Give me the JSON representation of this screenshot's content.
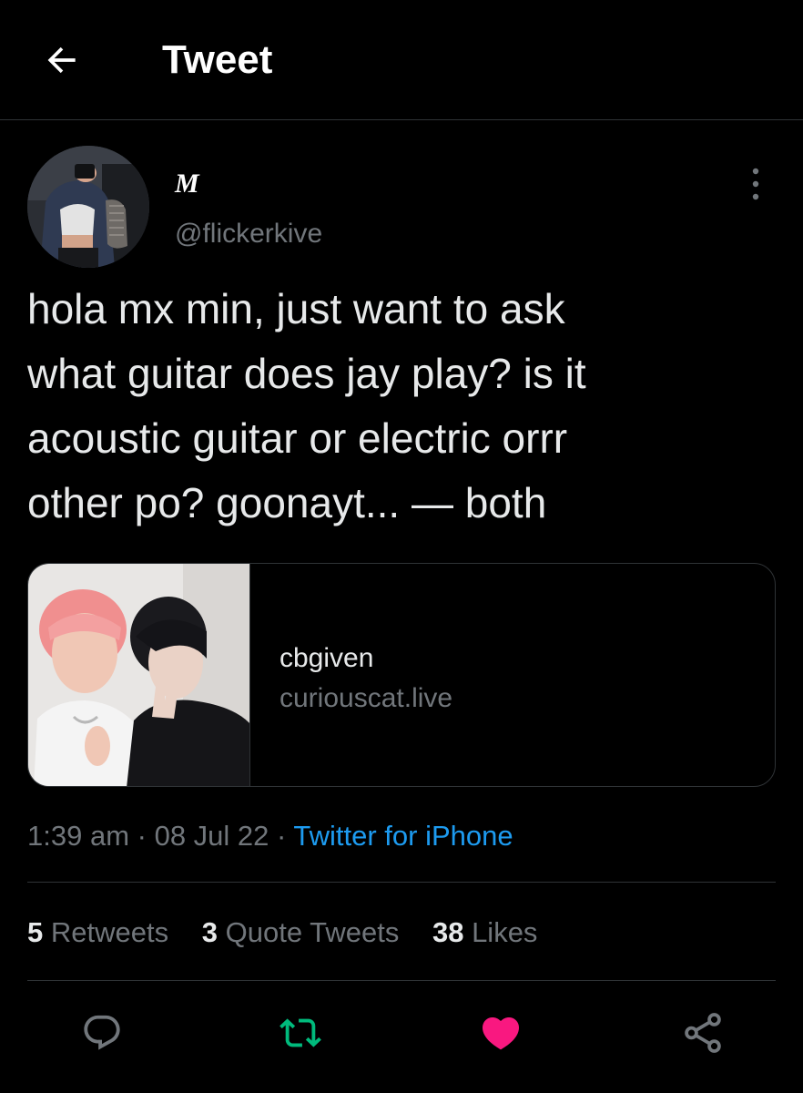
{
  "header": {
    "title": "Tweet",
    "back_icon": "arrow-left-icon"
  },
  "author": {
    "display_name": "M",
    "handle": "@flickerkive"
  },
  "tweet": {
    "text": "hola mx min, just want to ask\nwhat guitar does jay play? is it\nacoustic guitar or electric orrr\nother po? goonayt... — both"
  },
  "card": {
    "title": "cbgiven",
    "domain": "curiouscat.live"
  },
  "meta": {
    "time": "1:39 am",
    "separator": " · ",
    "date": "08 Jul 22",
    "source": "Twitter for iPhone"
  },
  "stats": {
    "retweets_count": "5",
    "retweets_label": "Retweets",
    "quotes_count": "3",
    "quotes_label": "Quote Tweets",
    "likes_count": "38",
    "likes_label": "Likes"
  },
  "actions": {
    "reply_icon": "reply-icon",
    "retweet_icon": "retweet-icon",
    "like_icon": "heart-icon",
    "share_icon": "share-icon",
    "retweet_color": "#00ba7c",
    "like_color": "#f91880",
    "retweeted": true,
    "liked": true
  },
  "colors": {
    "background": "#000000",
    "text": "#e7e9ea",
    "secondary": "#71767b",
    "link": "#1d9bf0",
    "border": "#2f3336"
  }
}
